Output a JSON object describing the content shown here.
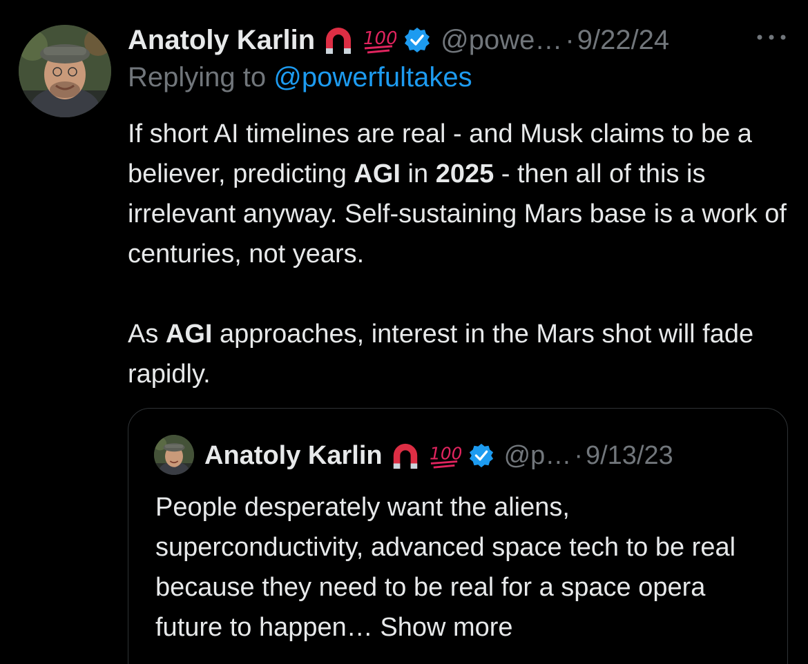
{
  "tweet": {
    "author_name": "Anatoly Karlin",
    "badges": [
      "magnet-emoji",
      "hundred-points-emoji",
      "verified-badge"
    ],
    "hundred_text": "100",
    "handle": "@powe…",
    "separator": "·",
    "date": "9/22/24",
    "reply_prefix": "Replying to ",
    "reply_handle": "@powerfultakes",
    "paragraph1": [
      {
        "text": "If short AI timelines are real - and Musk claims to be a believer, predicting ",
        "bold": false
      },
      {
        "text": "AGI",
        "bold": true
      },
      {
        "text": " in ",
        "bold": false
      },
      {
        "text": "2025",
        "bold": true
      },
      {
        "text": " - then all of this is irrelevant anyway. Self-sustaining Mars base is a work of centuries, not years.",
        "bold": false
      }
    ],
    "paragraph2": [
      {
        "text": "As ",
        "bold": false
      },
      {
        "text": "AGI",
        "bold": true
      },
      {
        "text": " approaches, interest in the Mars shot will fade rapidly.",
        "bold": false
      }
    ]
  },
  "quoted": {
    "author_name": "Anatoly Karlin",
    "hundred_text": "100",
    "handle": "@p…",
    "separator": "·",
    "date": "9/13/23",
    "text": "People desperately want the aliens, superconductivity, advanced space tech to be real because they need to be real for a space opera future to happen… ",
    "show_more": "Show more"
  },
  "colors": {
    "background": "#000000",
    "text": "#e7e9ea",
    "muted": "#71767b",
    "link": "#1d9bf0",
    "border": "#2f3336",
    "verified": "#1d9bf0",
    "hundred": "#e0245e"
  },
  "icons": {
    "more": "more-horizontal-icon",
    "verified": "verified-badge-icon",
    "magnet": "magnet-emoji-icon",
    "hundred": "hundred-points-emoji-icon"
  }
}
